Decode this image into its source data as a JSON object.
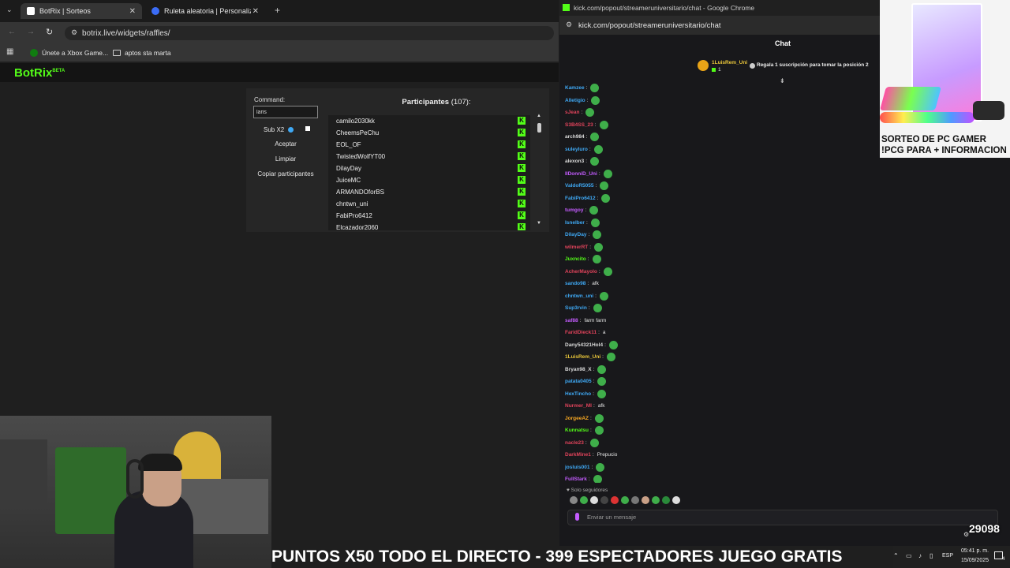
{
  "browser": {
    "tabs": [
      {
        "label": "BotRix | Sorteos",
        "active": true
      },
      {
        "label": "Ruleta aleatoria | Personaliza y",
        "active": false
      }
    ],
    "url": "botrix.live/widgets/raffles/",
    "bookmarks": [
      "Únete a Xbox Game...",
      "aptos sta marta"
    ]
  },
  "site": {
    "logo": "BotRix",
    "logo_tag": "BETA"
  },
  "raffle": {
    "command_label": "Command:",
    "command_value": "laris",
    "sub_label": "Sub X2",
    "accept_label": "Aceptar",
    "clear_label": "Limpiar",
    "copy_label": "Copiar participantes",
    "participants_label": "Participantes",
    "participants_count": "(107):",
    "participants": [
      "camilo2030kk",
      "CheemsPeChu",
      "EOL_OF",
      "TwistedWolfYT00",
      "DilayDay",
      "JuiceMC",
      "ARMANDOforBS",
      "chntwn_uni",
      "FabiPro6412",
      "Elcazador2060"
    ]
  },
  "chat_window": {
    "title": "kick.com/popout/streameruniversitario/chat - Google Chrome",
    "url": "kick.com/popout/streameruniversitario/chat",
    "header": "Chat",
    "pinned_user": "1LuisRem_Uni",
    "pinned_count": "1",
    "pinned_text": "Regala 1 suscripción para tomar la posición 2",
    "messages": [
      {
        "user": "Kamzee",
        "color": "#3fa9f5",
        "text": ""
      },
      {
        "user": "Alletigio",
        "color": "#3fa9f5",
        "text": ""
      },
      {
        "user": "sJean",
        "color": "#e0435b",
        "text": ""
      },
      {
        "user": "S3B4SS_23",
        "color": "#e0435b",
        "text": ""
      },
      {
        "user": "arch984",
        "color": "#d9d9d9",
        "text": ""
      },
      {
        "user": "suleyluro",
        "color": "#3fa9f5",
        "text": ""
      },
      {
        "user": "alexon3",
        "color": "#d9d9d9",
        "text": ""
      },
      {
        "user": "IIDonniD_Uni",
        "color": "#c45cff",
        "text": ""
      },
      {
        "user": "ValdoR5055",
        "color": "#3fa9f5",
        "text": ""
      },
      {
        "user": "FabiPro6412",
        "color": "#3fa9f5",
        "text": ""
      },
      {
        "user": "tumgoy",
        "color": "#c45cff",
        "text": ""
      },
      {
        "user": "Isnelber",
        "color": "#3fa9f5",
        "text": ""
      },
      {
        "user": "DilayDay",
        "color": "#3fa9f5",
        "text": ""
      },
      {
        "user": "wilmerRT",
        "color": "#e0435b",
        "text": ""
      },
      {
        "user": "Juxncito",
        "color": "#53fc18",
        "text": ""
      },
      {
        "user": "AcherMayolo",
        "color": "#e0435b",
        "text": ""
      },
      {
        "user": "sando98",
        "color": "#3fa9f5",
        "text": "afk"
      },
      {
        "user": "chntwn_uni",
        "color": "#3fa9f5",
        "text": ""
      },
      {
        "user": "Sup3rvin",
        "color": "#3fa9f5",
        "text": ""
      },
      {
        "user": "saf88",
        "color": "#c45cff",
        "text": "farm farm"
      },
      {
        "user": "FaridDieck11",
        "color": "#e0435b",
        "text": "a"
      },
      {
        "user": "Dany54321Hol4",
        "color": "#d9d9d9",
        "text": ""
      },
      {
        "user": "1LuisRem_Uni",
        "color": "#e8c53a",
        "text": ""
      },
      {
        "user": "Bryan98_X",
        "color": "#d9d9d9",
        "text": ""
      },
      {
        "user": "patata0405",
        "color": "#3fa9f5",
        "text": ""
      },
      {
        "user": "HexTincho",
        "color": "#3fa9f5",
        "text": ""
      },
      {
        "user": "Nurmer_MI",
        "color": "#e0435b",
        "text": "afk"
      },
      {
        "user": "JorgeeAZ",
        "color": "#f5a623",
        "text": ""
      },
      {
        "user": "Kunnatsu",
        "color": "#53fc18",
        "text": ""
      },
      {
        "user": "nacle23",
        "color": "#e0435b",
        "text": ""
      },
      {
        "user": "DarkMine1",
        "color": "#e0435b",
        "text": "Prepucio"
      },
      {
        "user": "josluis001",
        "color": "#3fa9f5",
        "text": ""
      },
      {
        "user": "FullStark",
        "color": "#c45cff",
        "text": ""
      }
    ],
    "followers_only": "Solo seguidores",
    "input_placeholder": "Enviar un mensaje"
  },
  "promo": {
    "line1": "SORTEO DE PC GAMER",
    "line2": "!PCG PARA + INFORMACION"
  },
  "ticker": "PUNTOS X50 TODO EL DIRECTO - 399 ESPECTADORES JUEGO GRATIS",
  "points": "29098",
  "taskbar": {
    "lang": "ESP",
    "time": "05:41 p. m.",
    "date": "15/09/2025",
    "notifications": "4"
  },
  "colors": {
    "kick_green": "#53fc18",
    "chat_bg": "#18181b"
  }
}
